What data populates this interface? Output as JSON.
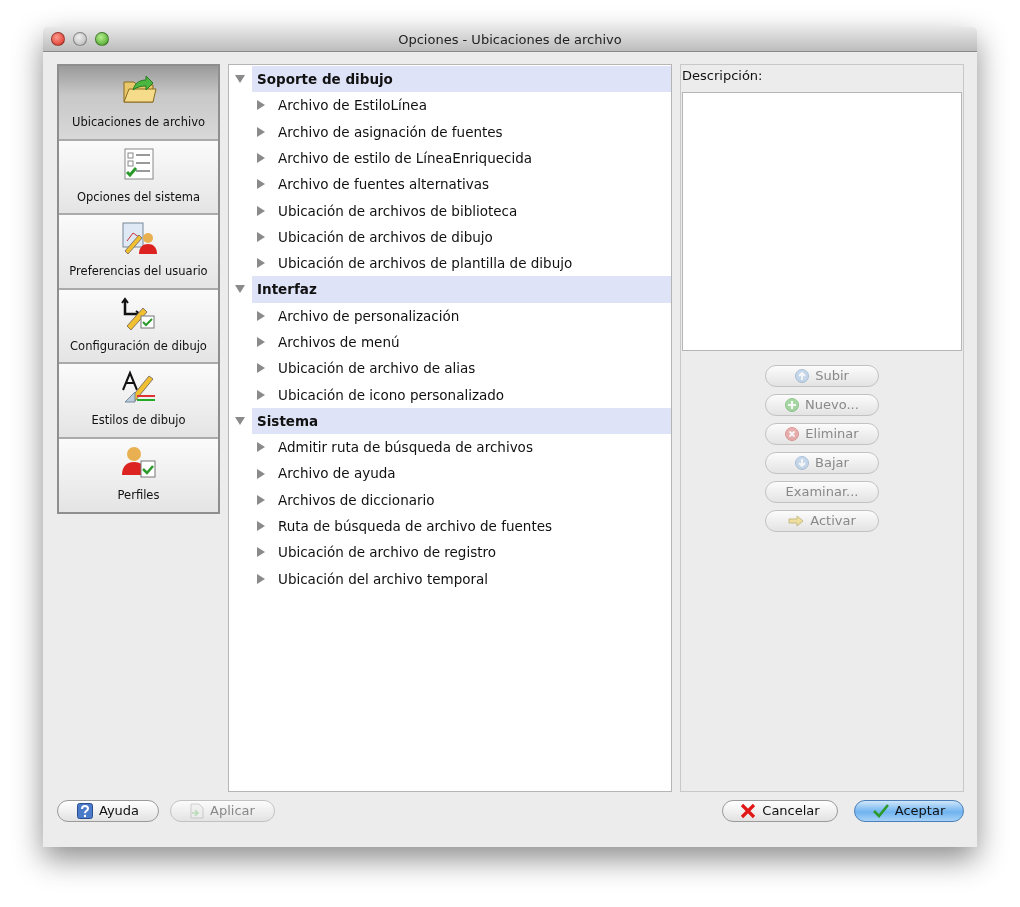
{
  "window": {
    "title": "Opciones - Ubicaciones de archivo"
  },
  "sidebar": {
    "items": [
      {
        "label": "Ubicaciones de archivo",
        "selected": true
      },
      {
        "label": "Opciones del sistema",
        "selected": false
      },
      {
        "label": "Preferencias del usuario",
        "selected": false
      },
      {
        "label": "Configuración de dibujo",
        "selected": false
      },
      {
        "label": "Estilos de dibujo",
        "selected": false
      },
      {
        "label": "Perfiles",
        "selected": false
      }
    ]
  },
  "tree": [
    {
      "label": "Soporte de dibujo",
      "expanded": true,
      "children": [
        {
          "label": "Archivo de EstiloLínea",
          "expanded": false
        },
        {
          "label": "Archivo de asignación de fuentes",
          "expanded": false
        },
        {
          "label": "Archivo de estilo de LíneaEnriquecida",
          "expanded": false
        },
        {
          "label": "Archivo de fuentes alternativas",
          "expanded": false
        },
        {
          "label": "Ubicación de archivos de biblioteca",
          "expanded": false
        },
        {
          "label": "Ubicación de archivos de dibujo",
          "expanded": false
        },
        {
          "label": "Ubicación de archivos de plantilla de dibujo",
          "expanded": false
        }
      ]
    },
    {
      "label": "Interfaz",
      "expanded": true,
      "children": [
        {
          "label": "Archivo de personalización",
          "expanded": false
        },
        {
          "label": "Archivos de menú",
          "expanded": false
        },
        {
          "label": "Ubicación de archivo de alias",
          "expanded": false
        },
        {
          "label": "Ubicación de icono personalizado",
          "expanded": false
        }
      ]
    },
    {
      "label": "Sistema",
      "expanded": true,
      "children": [
        {
          "label": "Admitir ruta de búsqueda de archivos",
          "expanded": false
        },
        {
          "label": "Archivo de ayuda",
          "expanded": false
        },
        {
          "label": "Archivos de diccionario",
          "expanded": false
        },
        {
          "label": "Ruta de búsqueda de archivo de fuentes",
          "expanded": false
        },
        {
          "label": "Ubicación de archivo de registro",
          "expanded": false
        },
        {
          "label": "Ubicación del archivo temporal",
          "expanded": false
        }
      ]
    }
  ],
  "description": {
    "label": "Descripción:"
  },
  "side_buttons": [
    {
      "label": "Subir",
      "kind": "up",
      "disabled": true
    },
    {
      "label": "Nuevo...",
      "kind": "add",
      "disabled": true
    },
    {
      "label": "Eliminar",
      "kind": "remove",
      "disabled": true
    },
    {
      "label": "Bajar",
      "kind": "down",
      "disabled": true
    },
    {
      "label": "Examinar...",
      "kind": "plain",
      "disabled": true
    },
    {
      "label": "Activar",
      "kind": "arrow",
      "disabled": true
    }
  ],
  "footer_buttons": [
    {
      "label": "Ayuda",
      "kind": "help",
      "disabled": false
    },
    {
      "label": "Aplicar",
      "kind": "apply",
      "disabled": true
    },
    {
      "label": "Cancelar",
      "kind": "cancel",
      "disabled": false
    },
    {
      "label": "Aceptar",
      "kind": "ok",
      "disabled": false
    }
  ]
}
